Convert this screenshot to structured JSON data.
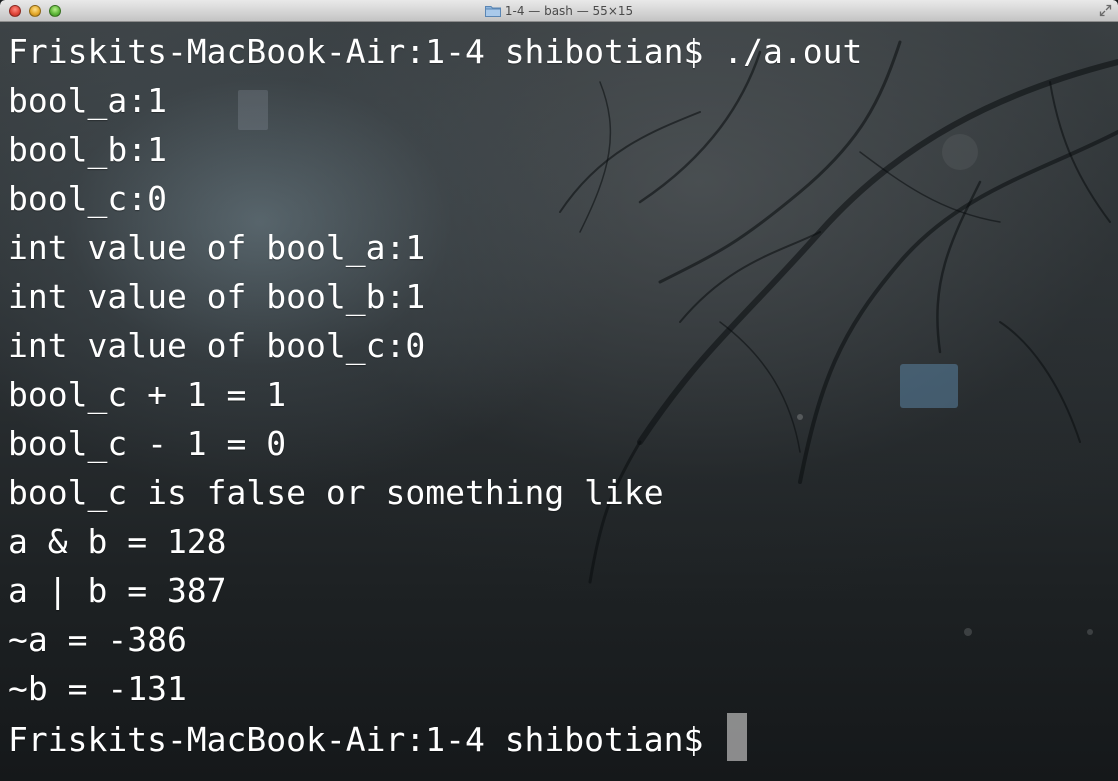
{
  "window": {
    "title": "1-4 — bash — 55×15"
  },
  "terminal": {
    "lines": [
      "Friskits-MacBook-Air:1-4 shibotian$ ./a.out",
      "bool_a:1",
      "bool_b:1",
      "bool_c:0",
      "int value of bool_a:1",
      "int value of bool_b:1",
      "int value of bool_c:0",
      "bool_c + 1 = 1",
      "bool_c - 1 = 0",
      "bool_c is false or something like",
      "a & b = 128",
      "a | b = 387",
      "~a = -386",
      "~b = -131"
    ],
    "prompt": "Friskits-MacBook-Air:1-4 shibotian$ "
  },
  "colors": {
    "text": "#ffffff",
    "cursor": "#a0a0a0",
    "titlebar": "#d5d5d5"
  },
  "icons": {
    "title_icon": "folder-icon",
    "titlebar_right": "fullscreen-icon"
  }
}
